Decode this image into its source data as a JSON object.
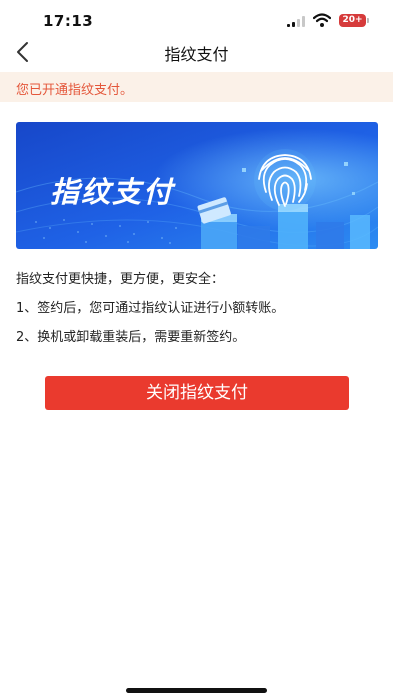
{
  "status_bar": {
    "time": "17:13",
    "battery": "20+",
    "battery_color": "#d63b3b"
  },
  "nav": {
    "back_icon": "chevron-left-icon",
    "title": "指纹支付"
  },
  "notice": {
    "text": "您已开通指纹支付。",
    "background": "#fbf1e8",
    "color": "#e4563a"
  },
  "banner": {
    "title": "指纹支付",
    "icon": "fingerprint-icon"
  },
  "description": {
    "lines": [
      "指纹支付更快捷，更方便，更安全：",
      "1、签约后，您可通过指纹认证进行小额转账。",
      "2、换机或卸载重装后，需要重新签约。"
    ]
  },
  "actions": {
    "close_label": "关闭指纹支付",
    "close_color": "#ea3a2e"
  }
}
